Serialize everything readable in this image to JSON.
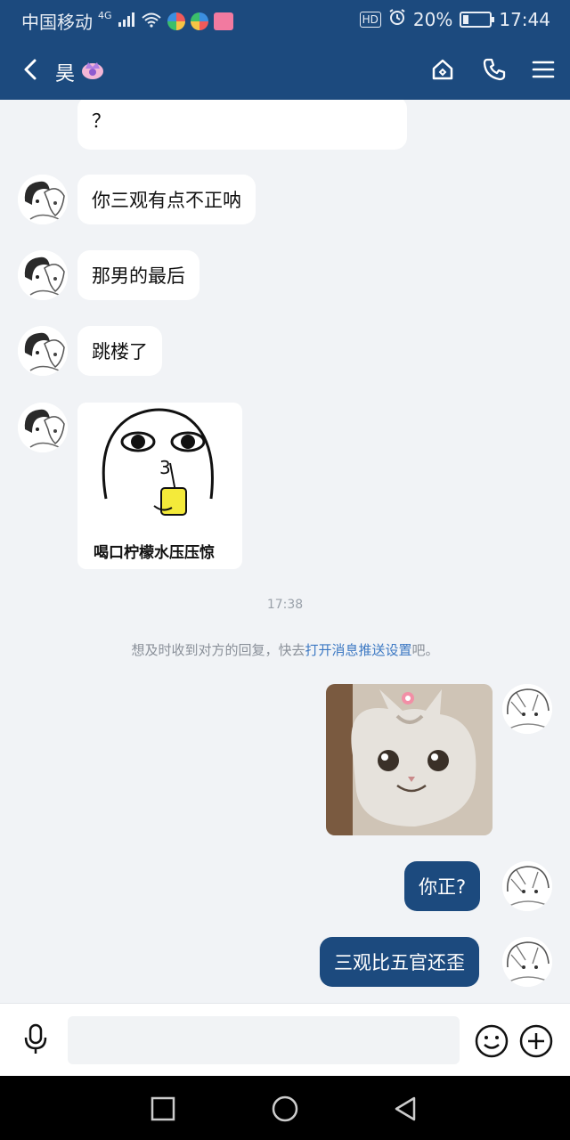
{
  "status_bar": {
    "carrier": "中国移动",
    "network": "4G",
    "hd": "HD",
    "battery": "20%",
    "battery_level": 0.2,
    "time": "17:44"
  },
  "header": {
    "contact_name": "昊",
    "icons": [
      "back-icon",
      "home-icon",
      "phone-icon",
      "menu-icon"
    ]
  },
  "messages": {
    "m0": "？",
    "m1": "你三观有点不正呐",
    "m2": "那男的最后",
    "m3": "跳楼了",
    "sticker_caption": "喝口柠檬水压压惊",
    "timestamp": "17:38",
    "notice_prefix": "想及时收到对方的回复，快去",
    "notice_link": "打开消息推送设置",
    "notice_suffix": "吧。",
    "m5": "你正?",
    "m6": "三观比五官还歪"
  },
  "input": {
    "placeholder": ""
  },
  "colors": {
    "header_bg": "#1c4a7e",
    "chat_bg": "#f1f3f6",
    "outgoing_bubble": "#1c4a7e",
    "link": "#3c78c3"
  }
}
